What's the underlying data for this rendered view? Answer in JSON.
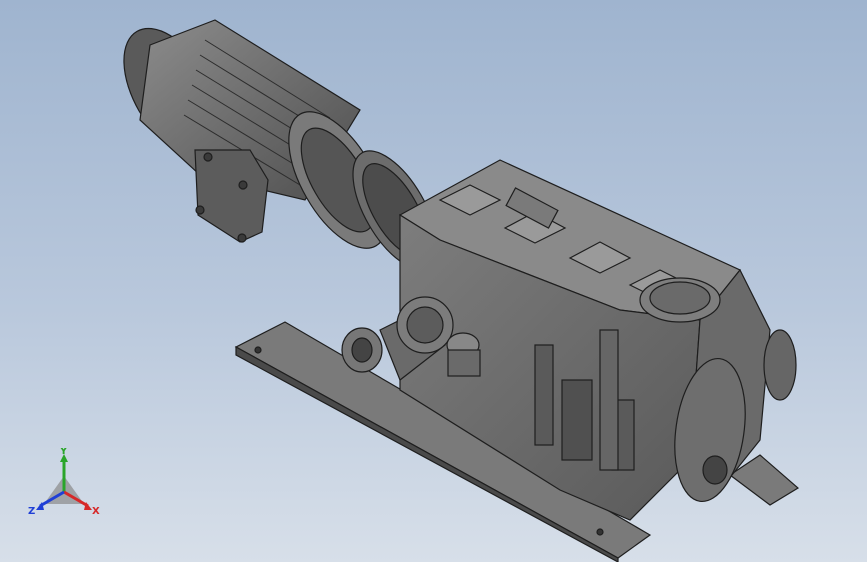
{
  "viewport": {
    "background_top": "#9fb4cf",
    "background_bottom": "#d7dfe9",
    "model_fill": "#6f6f6f",
    "model_dark": "#3a3a3a",
    "model_light": "#8a8a8a",
    "edge": "#1e1e1e"
  },
  "triad": {
    "x_label": "X",
    "y_label": "Y",
    "z_label": "Z",
    "x_color": "#d62828",
    "y_color": "#2aa52a",
    "z_color": "#1f3fd6"
  }
}
